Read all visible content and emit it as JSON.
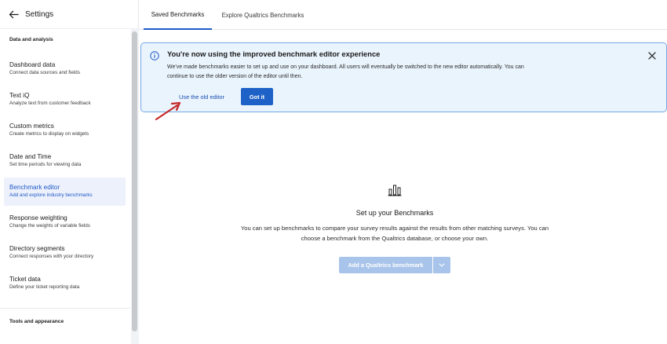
{
  "sidebar": {
    "title": "Settings",
    "sections": {
      "data": "Data and analysis",
      "tools": "Tools and appearance"
    },
    "items": [
      {
        "title": "Dashboard data",
        "desc": "Connect data sources and fields"
      },
      {
        "title": "Text iQ",
        "desc": "Analyze text from customer feedback"
      },
      {
        "title": "Custom metrics",
        "desc": "Create metrics to display on widgets"
      },
      {
        "title": "Date and Time",
        "desc": "Set time periods for viewing data"
      },
      {
        "title": "Benchmark editor",
        "desc": "Add and explore industry benchmarks"
      },
      {
        "title": "Response weighting",
        "desc": "Change the weights of variable fields"
      },
      {
        "title": "Directory segments",
        "desc": "Connect responses with your directory"
      },
      {
        "title": "Ticket data",
        "desc": "Define your ticket reporting data"
      }
    ],
    "active_item": "Benchmark editor"
  },
  "tabs": [
    {
      "label": "Saved Benchmarks"
    },
    {
      "label": "Explore Qualtrics Benchmarks"
    }
  ],
  "banner": {
    "title": "You're now using the improved benchmark editor experience",
    "body": "We've made benchmarks easier to set up and use on your dashboard. All users will eventually be switched to the new editor automatically. You can continue to use the older version of the editor until then.",
    "old_editor_label": "Use the old editor",
    "got_it_label": "Got it"
  },
  "empty_state": {
    "title": "Set up your Benchmarks",
    "description": "You can set up benchmarks to compare your survey results against the results from other matching surveys. You can choose a benchmark from the Qualtrics database, or choose your own.",
    "add_button_label": "Add a Qualtrics benchmark"
  },
  "icons": {
    "back": "arrow-left-icon",
    "info": "info-icon",
    "close": "close-icon",
    "empty": "bar-chart-icon",
    "dropdown": "chevron-down-icon",
    "annotation": "red-arrow-annotation"
  },
  "colors": {
    "accent": "#1e5ac8",
    "banner_bg": "#eaf4fd",
    "banner_border": "#74a8e6",
    "primary_button": "#1e62c7",
    "disabled_button": "#a9c4ea",
    "annotation": "#c62a2a"
  }
}
